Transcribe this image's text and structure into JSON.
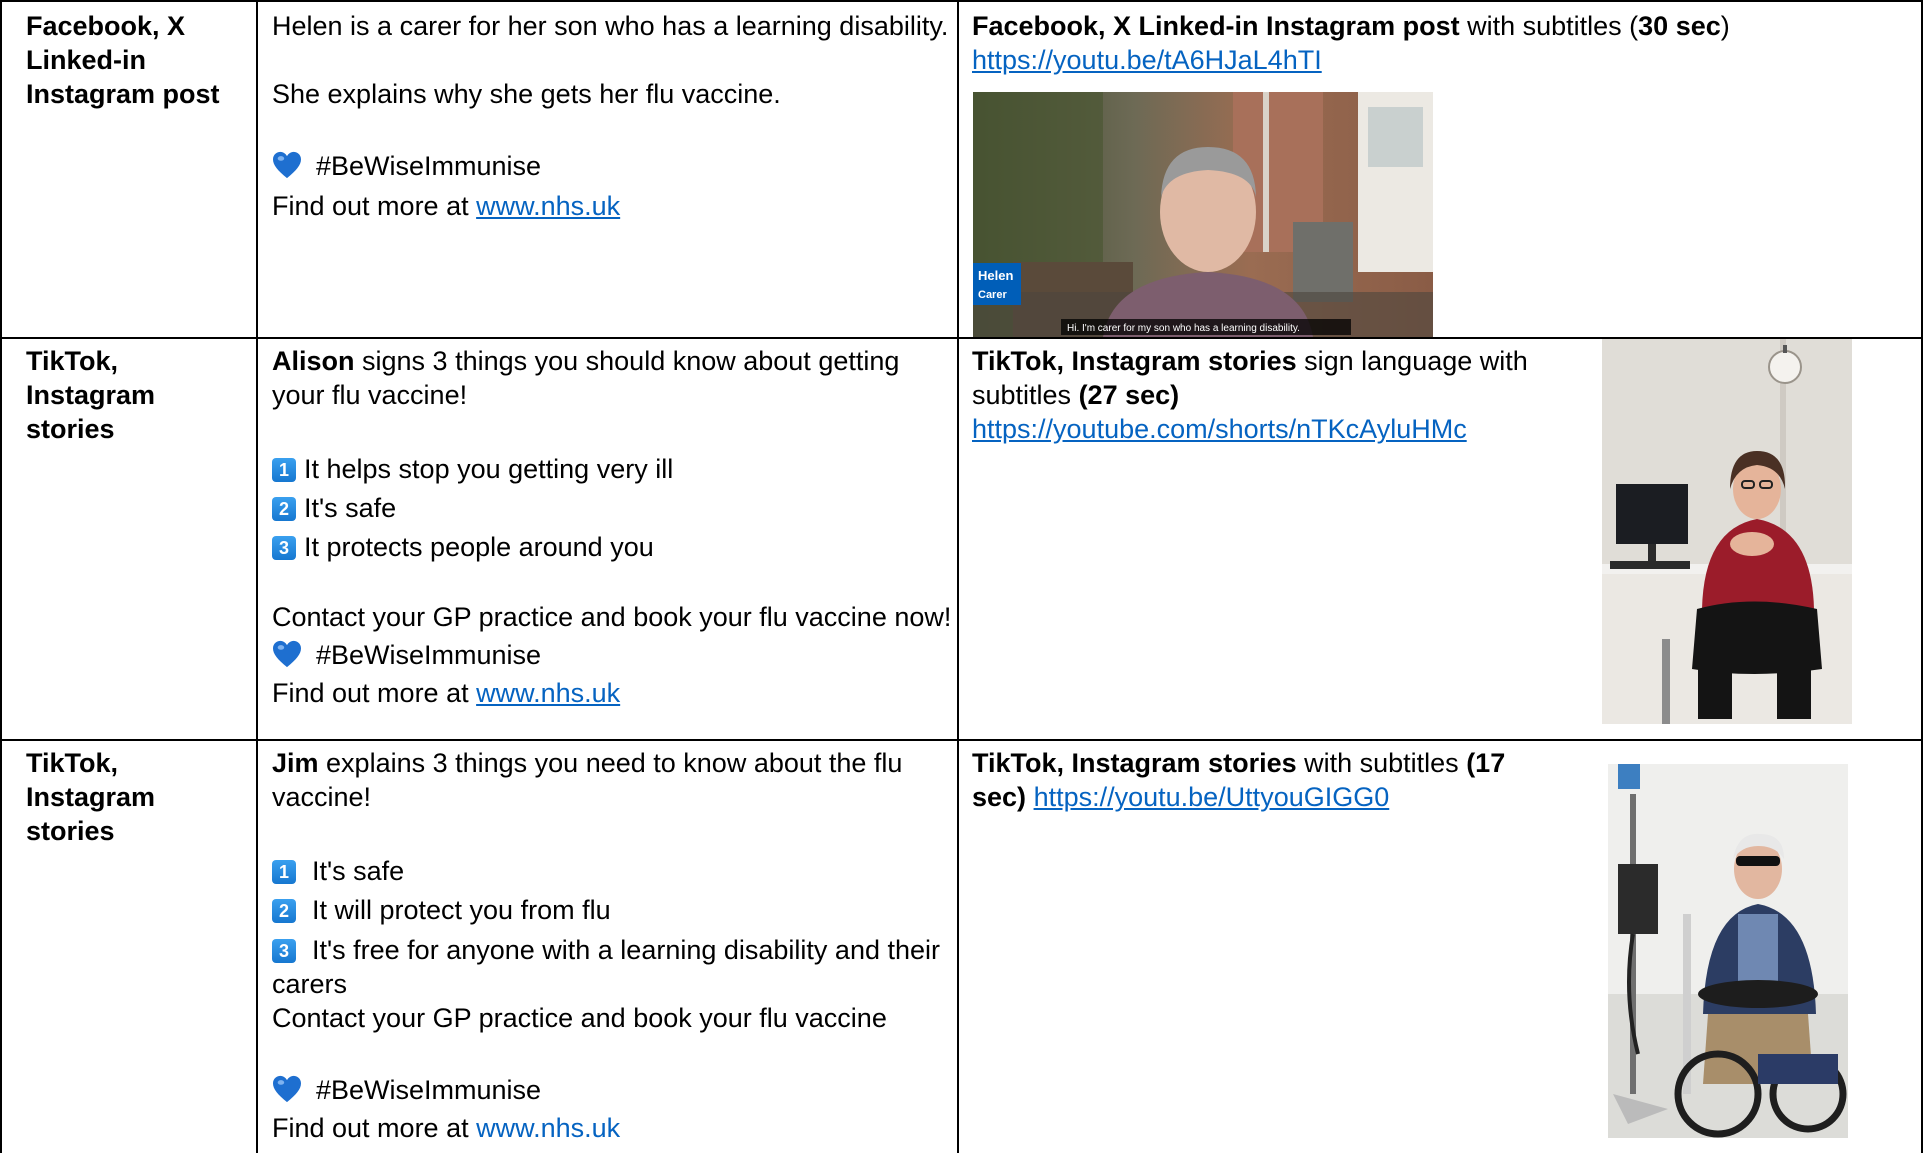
{
  "rows": [
    {
      "platform": "Facebook, X Linked-in Instagram post",
      "copy": {
        "intro": "Helen is a carer for her son who has a learning disability.",
        "line2": "She explains why she gets her flu vaccine.",
        "hashtag": "#BeWiseImmunise",
        "more_prefix": "Find out more at ",
        "more_link": "www.nhs.uk"
      },
      "asset": {
        "title_bold": "Facebook, X Linked-in Instagram post",
        "title_rest": " with subtitles (",
        "duration": "30 sec",
        "title_close": ")",
        "url": "https://youtu.be/tA6HJaL4hTI",
        "thumb_name": "Helen",
        "thumb_role": "Carer",
        "thumb_caption": "Hi. I'm carer for my son who has a learning disability."
      }
    },
    {
      "platform": "TikTok, Instagram stories",
      "copy": {
        "name": "Alison",
        "intro_rest": " signs 3 things you should know about getting your flu vaccine!",
        "points": [
          "It helps stop you getting very ill",
          "It's safe",
          "It protects people around you"
        ],
        "cta": "Contact your GP practice and book your flu vaccine now!",
        "hashtag": "#BeWiseImmunise",
        "more_prefix": "Find out more at ",
        "more_link": "www.nhs.uk"
      },
      "asset": {
        "title_bold": "TikTok, Instagram stories",
        "title_rest": " sign language with subtitles ",
        "duration": "(27 sec)",
        "url": "https://youtube.com/shorts/nTKcAyluHMc"
      }
    },
    {
      "platform": "TikTok, Instagram stories",
      "copy": {
        "name": "Jim",
        "intro_rest": " explains 3 things you need to know about the flu vaccine!",
        "points": [
          "It's safe",
          "It will protect you from flu",
          "It's free for anyone with a learning disability and their carers"
        ],
        "cta": "Contact your GP practice and book your flu vaccine",
        "hashtag": "#BeWiseImmunise",
        "more_prefix": "Find out more at ",
        "more_link": "www.nhs.uk"
      },
      "asset": {
        "title_bold": "TikTok, Instagram stories",
        "title_rest": " with subtitles ",
        "duration": "(17 sec)",
        "url": "https://youtu.be/UttyouGIGG0"
      }
    }
  ],
  "badges": [
    "1",
    "2",
    "3"
  ],
  "colors": {
    "link": "#0563c1",
    "heart": "#1e6fd0",
    "badge": "#1f86e0",
    "nhs_blue": "#005eb8"
  }
}
